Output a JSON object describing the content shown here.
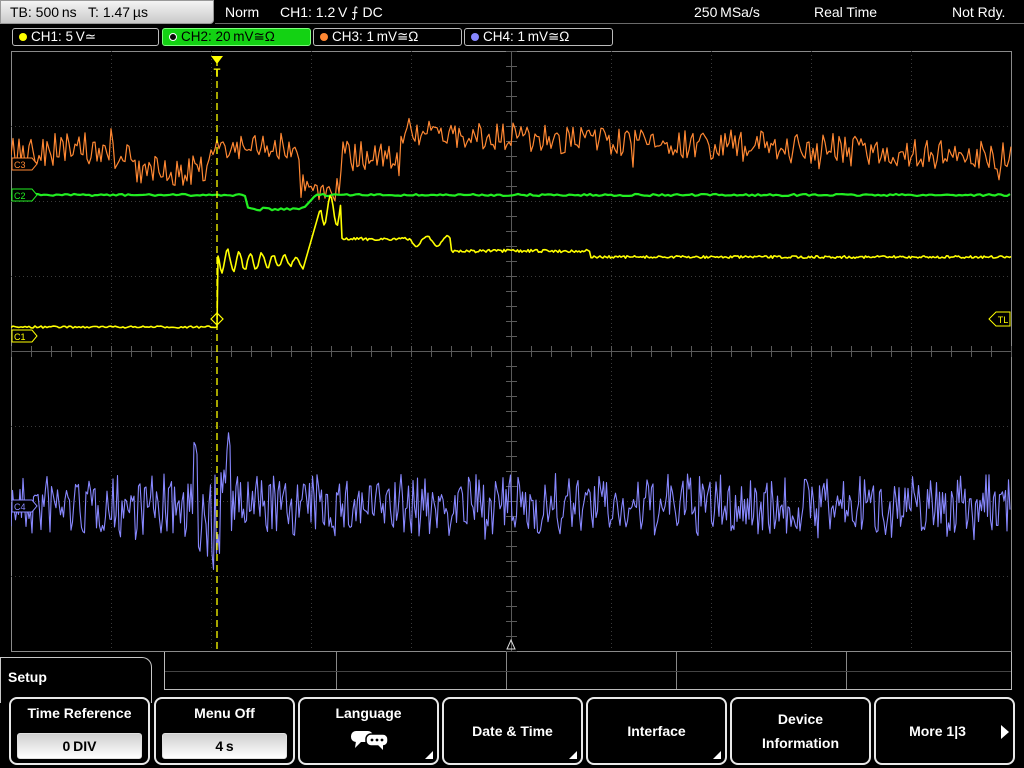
{
  "topbar": {
    "tb": "TB: 500 ns",
    "t": "T: 1.47 µs",
    "mode": "Norm",
    "trigger": "CH1: 1.2 V ⨍ DC",
    "sample_rate": "250 MSa/s",
    "acq_mode": "Real Time",
    "status": "Not Rdy."
  },
  "channels": [
    {
      "label": "CH1: 5 V≃",
      "color": "#ffff00"
    },
    {
      "label": "CH2: 20 mV≅Ω",
      "color": "#22ee22"
    },
    {
      "label": "CH3: 1 mV≅Ω",
      "color": "#ff8833"
    },
    {
      "label": "CH4: 1 mV≅Ω",
      "color": "#8888ff"
    }
  ],
  "markers": {
    "trigger": "T",
    "trigger_level": "TL",
    "c1": "C1",
    "c2": "C2",
    "c3": "C3",
    "c4": "C4"
  },
  "menu": {
    "title": "Setup",
    "softkeys": [
      {
        "label": "Time Reference",
        "value": "0 DIV"
      },
      {
        "label": "Menu Off",
        "value": "4 s"
      },
      {
        "label": "Language",
        "icon": "speech-bubbles-icon"
      },
      {
        "label": "Date & Time"
      },
      {
        "label": "Interface"
      },
      {
        "label_lines": [
          "Device",
          "Information"
        ]
      },
      {
        "label": "More 1|3"
      }
    ]
  }
}
